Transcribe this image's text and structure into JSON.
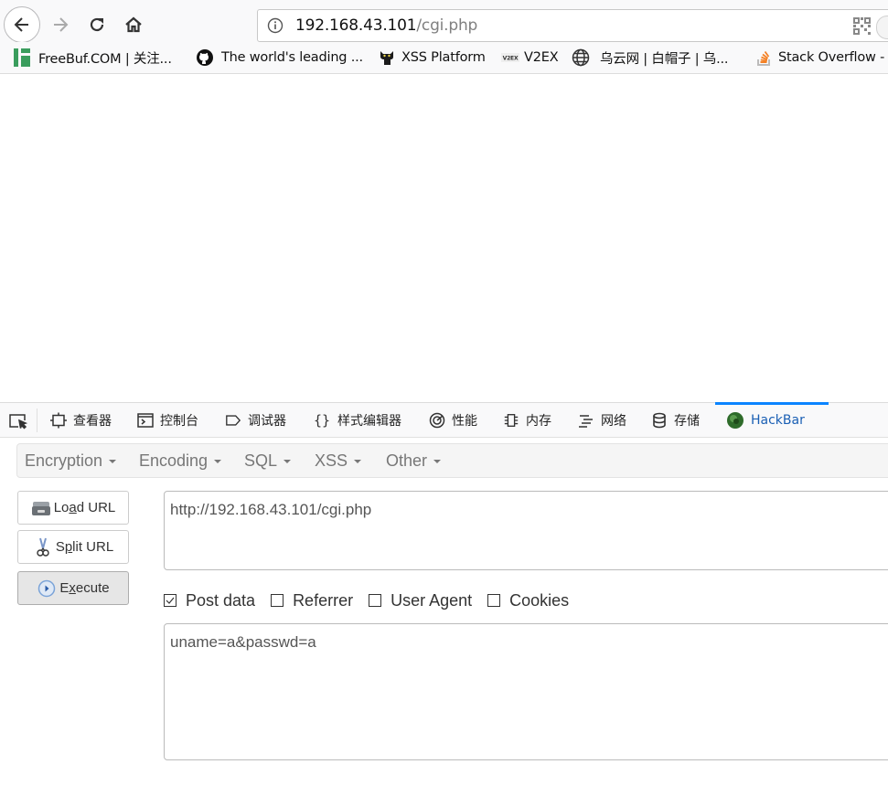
{
  "browser": {
    "nav": {
      "back": "back-arrow-icon",
      "forward": "forward-arrow-icon",
      "reload": "reload-icon",
      "home": "home-icon"
    },
    "address_bar": {
      "host": "192.168.43.101",
      "path": "/cgi.php",
      "info_icon": "info-icon",
      "qr_icon": "qr-code-icon"
    },
    "bookmarks": [
      {
        "label": "FreeBuf.COM | 关注...",
        "icon": "freebuf-logo-icon"
      },
      {
        "label": "The world's leading ...",
        "icon": "github-icon"
      },
      {
        "label": "XSS Platform",
        "icon": "cat-icon"
      },
      {
        "label": "V2EX",
        "icon": "v2ex-icon"
      },
      {
        "label": "乌云网 | 白帽子 | 乌...",
        "icon": "globe-icon"
      },
      {
        "label": "Stack Overflow -",
        "icon": "stackoverflow-icon"
      }
    ]
  },
  "devtools": {
    "tabs": [
      {
        "label": "查看器",
        "icon": "inspector-icon"
      },
      {
        "label": "控制台",
        "icon": "console-icon"
      },
      {
        "label": "调试器",
        "icon": "debugger-icon"
      },
      {
        "label": "样式编辑器",
        "icon": "braces-icon"
      },
      {
        "label": "性能",
        "icon": "performance-icon"
      },
      {
        "label": "内存",
        "icon": "memory-icon"
      },
      {
        "label": "网络",
        "icon": "network-icon"
      },
      {
        "label": "存储",
        "icon": "storage-icon"
      },
      {
        "label": "HackBar",
        "icon": "hackbar-icon",
        "active": true
      }
    ],
    "accent": "#0a84ff"
  },
  "hackbar": {
    "menu": [
      "Encryption",
      "Encoding",
      "SQL",
      "XSS",
      "Other"
    ],
    "buttons": {
      "load_pre": "Lo",
      "load_u": "a",
      "load_post": "d URL",
      "split_pre": "S",
      "split_u": "p",
      "split_post": "lit URL",
      "exec_pre": "E",
      "exec_u": "x",
      "exec_post": "ecute"
    },
    "url_value": "http://192.168.43.101/cgi.php",
    "options": [
      {
        "label": "Post data",
        "checked": true
      },
      {
        "label": "Referrer",
        "checked": false
      },
      {
        "label": "User Agent",
        "checked": false
      },
      {
        "label": "Cookies",
        "checked": false
      }
    ],
    "post_value": "uname=a&passwd=a"
  }
}
